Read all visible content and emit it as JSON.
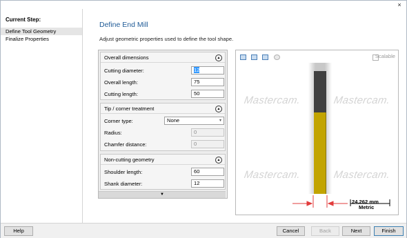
{
  "window": {
    "close_glyph": "×"
  },
  "steps": {
    "heading": "Current Step:",
    "items": [
      {
        "label": "Define Tool Geometry",
        "selected": true
      },
      {
        "label": "Finalize Properties",
        "selected": false
      }
    ]
  },
  "main": {
    "title": "Define End Mill",
    "description": "Adjust geometric properties used to define the tool shape."
  },
  "sections": {
    "overall": {
      "title": "Overall dimensions",
      "cutting_diameter": {
        "label": "Cutting diameter:",
        "value": "12"
      },
      "overall_length": {
        "label": "Overall length:",
        "value": "75"
      },
      "cutting_length": {
        "label": "Cutting length:",
        "value": "50"
      }
    },
    "tip": {
      "title": "Tip / corner treatment",
      "corner_type": {
        "label": "Corner type:",
        "value": "None"
      },
      "radius": {
        "label": "Radius:",
        "value": "0"
      },
      "chamfer_distance": {
        "label": "Chamfer distance:",
        "value": "0"
      }
    },
    "noncutting": {
      "title": "Non-cutting geometry",
      "shoulder_length": {
        "label": "Shoulder length:",
        "value": "60"
      },
      "shank_diameter": {
        "label": "Shank diameter:",
        "value": "12"
      }
    }
  },
  "preview": {
    "scalable_label": "Scalable",
    "scalable_checked": false,
    "watermark": "Mastercam.",
    "dimension_value": "24.262 mm",
    "dimension_unit": "Metric",
    "colors": {
      "shank": "#404040",
      "flute": "#c2a400",
      "arrow": "#e23c3c"
    }
  },
  "footer": {
    "help": "Help",
    "cancel": "Cancel",
    "back": "Back",
    "next": "Next",
    "finish": "Finish"
  }
}
